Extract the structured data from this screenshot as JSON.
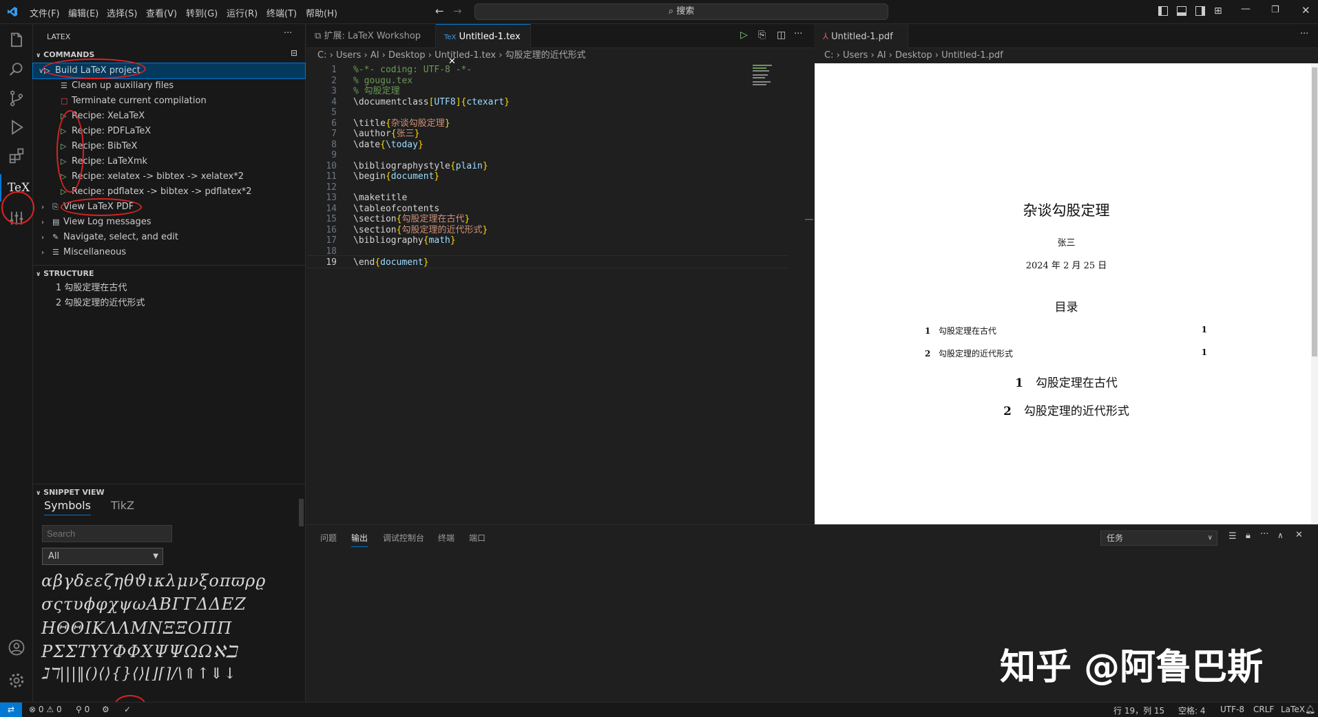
{
  "menu": [
    "文件(F)",
    "编辑(E)",
    "选择(S)",
    "查看(V)",
    "转到(G)",
    "运行(R)",
    "终端(T)",
    "帮助(H)"
  ],
  "search": {
    "label": "搜索"
  },
  "sidebar": {
    "title": "LATEX",
    "commands_header": "COMMANDS",
    "commands": [
      {
        "label": "Build LaTeX project",
        "icon": "play-icon"
      },
      {
        "label": "Clean up auxiliary files",
        "icon": "clean-icon"
      },
      {
        "label": "Terminate current compilation",
        "icon": "stop-icon"
      },
      {
        "label": "Recipe: XeLaTeX",
        "icon": "play-icon"
      },
      {
        "label": "Recipe: PDFLaTeX",
        "icon": "play-icon"
      },
      {
        "label": "Recipe: BibTeX",
        "icon": "play-icon"
      },
      {
        "label": "Recipe: LaTeXmk",
        "icon": "play-icon"
      },
      {
        "label": "Recipe: xelatex -> bibtex -> xelatex*2",
        "icon": "play-icon"
      },
      {
        "label": "Recipe: pdflatex -> bibtex -> pdflatex*2",
        "icon": "play-icon"
      },
      {
        "label": "View LaTeX PDF",
        "icon": "pdf-icon"
      },
      {
        "label": "View Log messages",
        "icon": "log-icon"
      },
      {
        "label": "Navigate, select, and edit",
        "icon": "edit-icon"
      },
      {
        "label": "Miscellaneous",
        "icon": "list-icon"
      }
    ],
    "structure_header": "STRUCTURE",
    "structure": [
      "1 勾股定理在古代",
      "2 勾股定理的近代形式"
    ],
    "snippet_header": "SNIPPET VIEW",
    "snippet_tabs": [
      "Symbols",
      "TikZ"
    ],
    "snippet_search_placeholder": "Search",
    "snippet_filter": "All",
    "symbol_rows": [
      "αβγδεεζηθϑικλμνξοπϖρϱ",
      "σςτυϕφχψωΑΒΓΓΔΔΕΖ",
      "ΗΘΘΙΚΛΛΜΝΞΞΟΠΠ",
      "ΡΣΣΤΥΥΦΦΧΨΨΩΩℵℶ",
      "ℷℸ|||‖()⟨⟩{}⟨⟩⌊⌋⌈⌉/\\⇑↑⇓↓"
    ]
  },
  "editor": {
    "tabs": [
      "扩展: LaTeX Workshop",
      "Untitled-1.tex"
    ],
    "breadcrumb": [
      "C:",
      "Users",
      "AI",
      "Desktop",
      "Untitled-1.tex",
      "勾股定理的近代形式"
    ],
    "lines": [
      {
        "n": "1",
        "t": "%-*- coding: UTF-8 -*-"
      },
      {
        "n": "2",
        "t": "% gougu.tex"
      },
      {
        "n": "3",
        "t": "% 勾股定理"
      },
      {
        "n": "4",
        "t": "\\documentclass[UTF8]{ctexart}"
      },
      {
        "n": "5",
        "t": ""
      },
      {
        "n": "6",
        "t": "\\title{杂谈勾股定理}"
      },
      {
        "n": "7",
        "t": "\\author{张三}"
      },
      {
        "n": "8",
        "t": "\\date{\\today}"
      },
      {
        "n": "9",
        "t": ""
      },
      {
        "n": "10",
        "t": "\\bibliographystyle{plain}"
      },
      {
        "n": "11",
        "t": "\\begin{document}"
      },
      {
        "n": "12",
        "t": ""
      },
      {
        "n": "13",
        "t": "\\maketitle"
      },
      {
        "n": "14",
        "t": "\\tableofcontents"
      },
      {
        "n": "15",
        "t": "\\section{勾股定理在古代}"
      },
      {
        "n": "16",
        "t": "\\section{勾股定理的近代形式}"
      },
      {
        "n": "17",
        "t": "\\bibliography{math}"
      },
      {
        "n": "18",
        "t": ""
      },
      {
        "n": "19",
        "t": "\\end{document}"
      }
    ]
  },
  "pdf": {
    "tab": "Untitled-1.pdf",
    "breadcrumb": [
      "C:",
      "Users",
      "AI",
      "Desktop",
      "Untitled-1.pdf"
    ],
    "title": "杂谈勾股定理",
    "author": "张三",
    "date": "2024 年 2 月 25 日",
    "toc_title": "目录",
    "toc": [
      {
        "num": "1",
        "text": "勾股定理在古代",
        "page": "1"
      },
      {
        "num": "2",
        "text": "勾股定理的近代形式",
        "page": "1"
      }
    ],
    "sections": [
      {
        "num": "1",
        "text": "勾股定理在古代"
      },
      {
        "num": "2",
        "text": "勾股定理的近代形式"
      }
    ]
  },
  "panel": {
    "tabs": [
      "问题",
      "输出",
      "调试控制台",
      "终端",
      "端口"
    ],
    "active_tab": "输出",
    "dropdown": "任务"
  },
  "watermark": "知乎 @阿鲁巴斯",
  "status": {
    "errors": "0",
    "warnings": "0",
    "ports": "0",
    "position": "行 19，列 15",
    "spaces": "空格: 4",
    "encoding": "UTF-8",
    "eol": "CRLF",
    "language": "LaTeX"
  },
  "colors": {
    "accent": "#0078d4",
    "play": "#89d185",
    "annotation": "#dd2222"
  }
}
